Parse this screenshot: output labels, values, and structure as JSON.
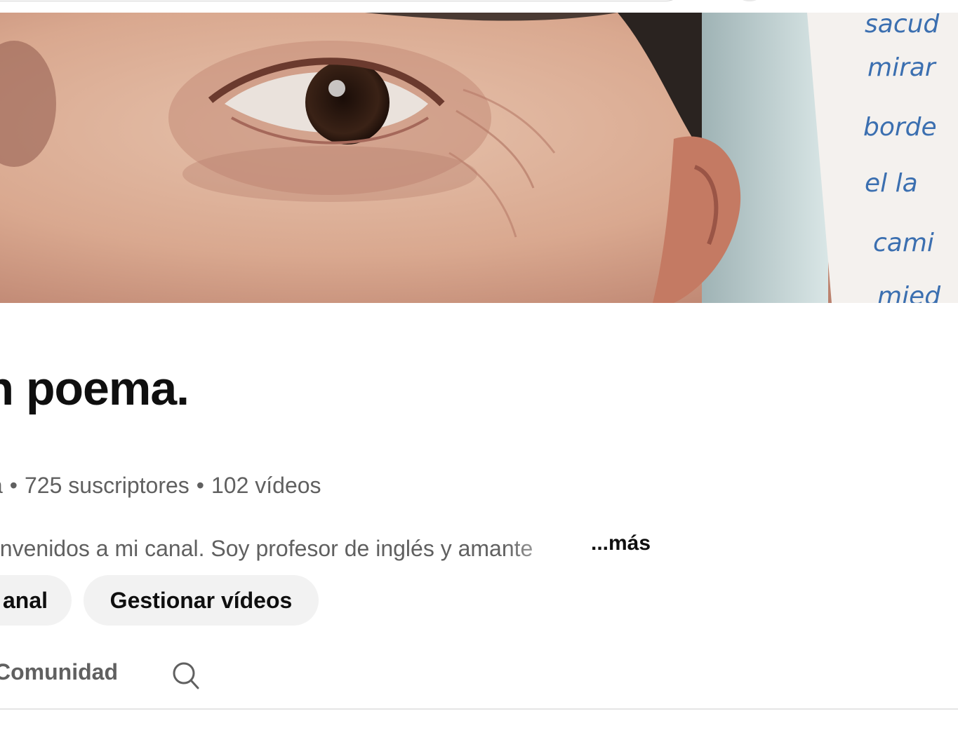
{
  "channel": {
    "title": "un poema.",
    "meta": {
      "handle_fragment": "a",
      "subscribers": "725 suscriptores",
      "videos": "102 vídeos",
      "separator": "•"
    },
    "description": "envenidos a mi canal. Soy profesor de inglés y amante",
    "more_label": "...más"
  },
  "banner": {
    "handwriting_lines": [
      "sacud",
      "mirar",
      "borde",
      "el la",
      "cami",
      "mied"
    ]
  },
  "actions": {
    "customize_label": "anal",
    "manage_label": "Gestionar vídeos"
  },
  "tabs": {
    "items": [
      {
        "label": "Comunidad"
      }
    ],
    "search_icon": "search-icon"
  },
  "colors": {
    "text_primary": "#0f0f0f",
    "text_secondary": "#606060",
    "button_bg": "#f2f2f2",
    "divider": "#e5e5e5",
    "handwriting_ink": "#3b6fb0"
  }
}
